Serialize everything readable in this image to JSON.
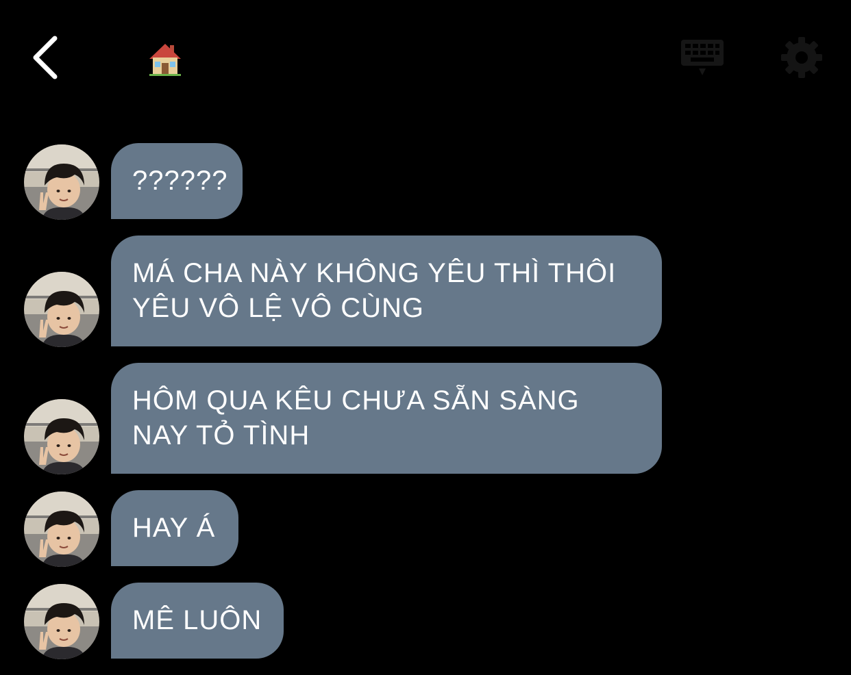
{
  "header": {
    "back_icon": "chevron-left-icon",
    "title_emoji": "house-icon",
    "keyboard_icon": "keyboard-icon",
    "settings_icon": "gear-icon"
  },
  "messages": [
    {
      "text": "??????"
    },
    {
      "text": "MÁ CHA NÀY KHÔNG YÊU THÌ THÔI\nYÊU VÔ LỆ VÔ CÙNG"
    },
    {
      "text": "HÔM QUA KÊU CHƯA SẴN SÀNG\nNAY TỎ TÌNH"
    },
    {
      "text": "HAY Á"
    },
    {
      "text": "MÊ LUÔN"
    }
  ],
  "colors": {
    "background": "#000000",
    "bubble": "#66788a",
    "bubble_text": "#ffffff"
  }
}
